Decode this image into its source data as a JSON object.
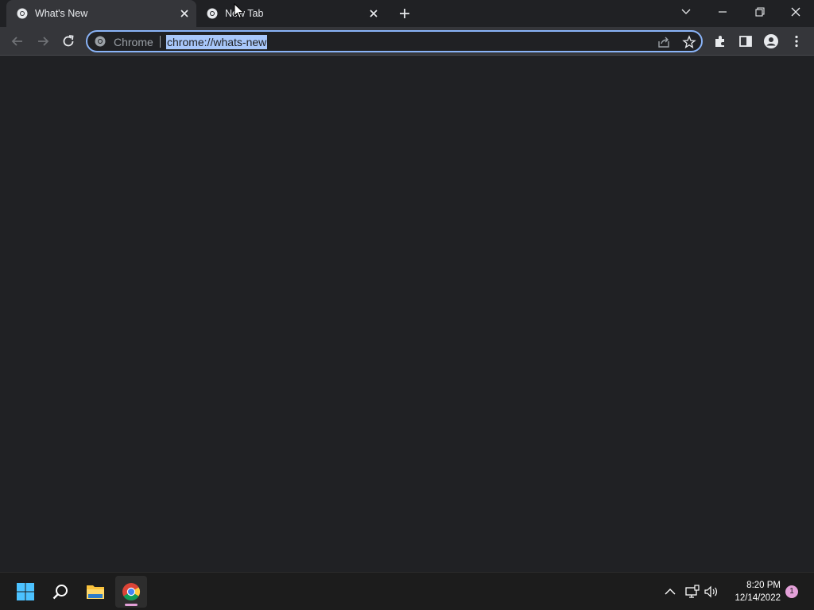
{
  "tabs": [
    {
      "title": "What's New",
      "active": true
    },
    {
      "title": "New Tab",
      "active": false
    }
  ],
  "omnibox": {
    "chip": "Chrome",
    "url": "chrome://whats-new"
  },
  "taskbar": {
    "time": "8:20 PM",
    "date": "12/14/2022",
    "notification_count": "1"
  },
  "colors": {
    "accent_focus": "#8ab4f8",
    "selection": "#a8c7fa",
    "background": "#202124",
    "toolbar": "#35363a",
    "taskbar": "#1c1c1c"
  },
  "icons": [
    "chrome-favicon-icon",
    "close-icon",
    "plus-icon",
    "chevron-down-icon",
    "minimize-icon",
    "restore-icon",
    "window-close-icon",
    "back-icon",
    "forward-icon",
    "reload-icon",
    "share-icon",
    "star-icon",
    "extensions-icon",
    "side-panel-icon",
    "profile-icon",
    "menu-icon",
    "windows-start-icon",
    "search-icon",
    "file-explorer-icon",
    "chrome-icon",
    "chevron-up-icon",
    "network-icon",
    "volume-icon"
  ]
}
